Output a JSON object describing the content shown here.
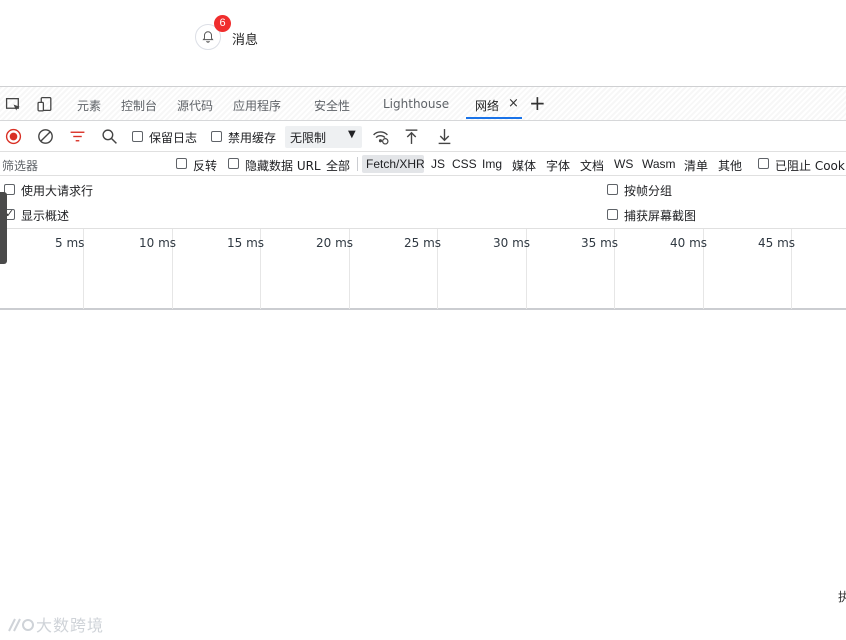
{
  "page": {
    "notification": {
      "icon": "bell-icon",
      "badge": "6",
      "label": "消息"
    },
    "watermark": "大数跨境",
    "edge_text": "执"
  },
  "devtools": {
    "tabs": {
      "icons": [
        "inspect-element-icon",
        "device-toolbar-icon"
      ],
      "items": [
        "元素",
        "控制台",
        "源代码",
        "应用程序",
        "安全性",
        "Lighthouse",
        "网络"
      ],
      "active": "网络",
      "close": "×",
      "add": "+"
    },
    "toolbar": {
      "icons": [
        "record-stop-icon",
        "clear-icon",
        "filter-icon",
        "search-icon",
        "network-conditions-icon",
        "import-har-icon",
        "export-har-icon"
      ],
      "preserve_log": {
        "label": "保留日志",
        "checked": false
      },
      "disable_cache": {
        "label": "禁用缓存",
        "checked": false
      },
      "throttling": {
        "value": "无限制",
        "arrow": "▼"
      }
    },
    "filter": {
      "placeholder": "筛选器",
      "invert": {
        "label": "反转",
        "checked": false
      },
      "hide_data_urls": {
        "label": "隐藏数据 URL",
        "checked": false
      },
      "types": [
        "全部",
        "Fetch/XHR",
        "JS",
        "CSS",
        "Img",
        "媒体",
        "字体",
        "文档",
        "WS",
        "Wasm",
        "清单",
        "其他"
      ],
      "active_type": "Fetch/XHR",
      "blocked_cookies": {
        "label": "已阻止 Cooki",
        "checked": false
      }
    },
    "settings": {
      "large_rows": {
        "label": "使用大请求行",
        "checked": false
      },
      "show_overview": {
        "label": "显示概述",
        "checked": true
      },
      "group_by_frame": {
        "label": "按帧分组",
        "checked": false
      },
      "capture_screenshots": {
        "label": "捕获屏幕截图",
        "checked": false
      }
    },
    "timeline": {
      "ticks": [
        "5 ms",
        "10 ms",
        "15 ms",
        "20 ms",
        "25 ms",
        "30 ms",
        "35 ms",
        "40 ms",
        "45 ms"
      ]
    }
  },
  "colors": {
    "record": "#d93025",
    "filter": "#d93025",
    "active_tab": "#1a73e8",
    "badge": "#f02d2d"
  }
}
